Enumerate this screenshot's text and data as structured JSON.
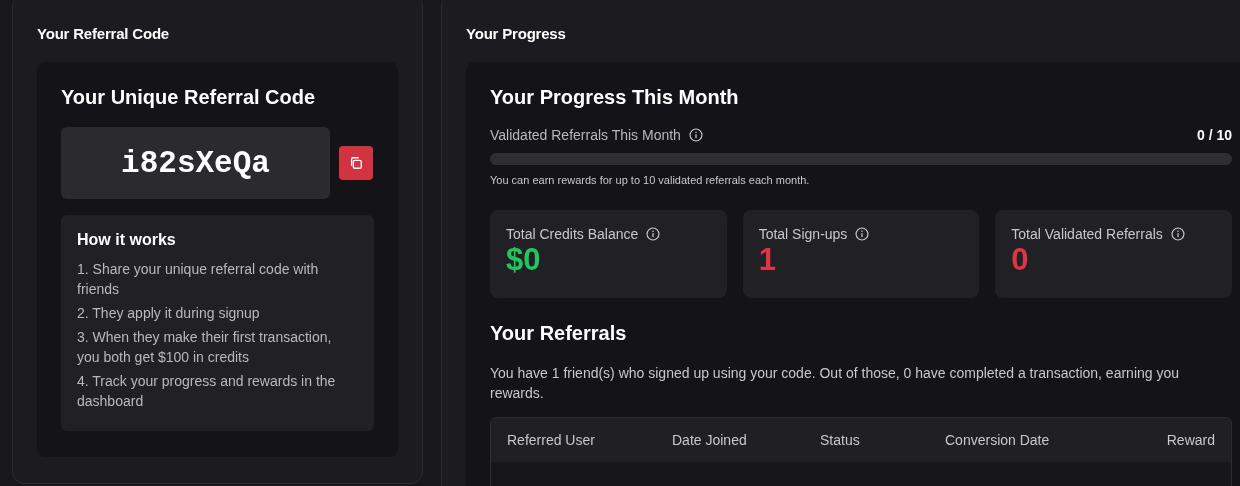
{
  "referral_card": {
    "title": "Your Referral Code",
    "heading": "Your Unique Referral Code",
    "code": "i82sXeQa",
    "how_it_works": {
      "title": "How it works",
      "steps": [
        "1. Share your unique referral code with friends",
        "2. They apply it during signup",
        "3. When they make their first transaction, you both get $100 in credits",
        "4. Track your progress and rewards in the dashboard"
      ]
    }
  },
  "progress_card": {
    "title": "Your Progress",
    "heading": "Your Progress This Month",
    "progress": {
      "label": "Validated Referrals This Month",
      "reading": "0 / 10",
      "level": 0,
      "note": "You can earn rewards for up to 10 validated referrals each month."
    },
    "stats": [
      {
        "label": "Total Credits Balance",
        "value": "$0",
        "color": "#22c55e"
      },
      {
        "label": "Total Sign-ups",
        "value": "1",
        "color": "#dc3545"
      },
      {
        "label": "Total Validated Referrals",
        "value": "0",
        "color": "#dc3545"
      }
    ],
    "referrals": {
      "heading": "Your Referrals",
      "summary": "You have 1 friend(s) who signed up using your code. Out of those, 0 have completed a transaction, earning you rewards.",
      "columns": [
        "Referred User",
        "Date Joined",
        "Status",
        "Conversion Date",
        "Reward"
      ]
    }
  }
}
